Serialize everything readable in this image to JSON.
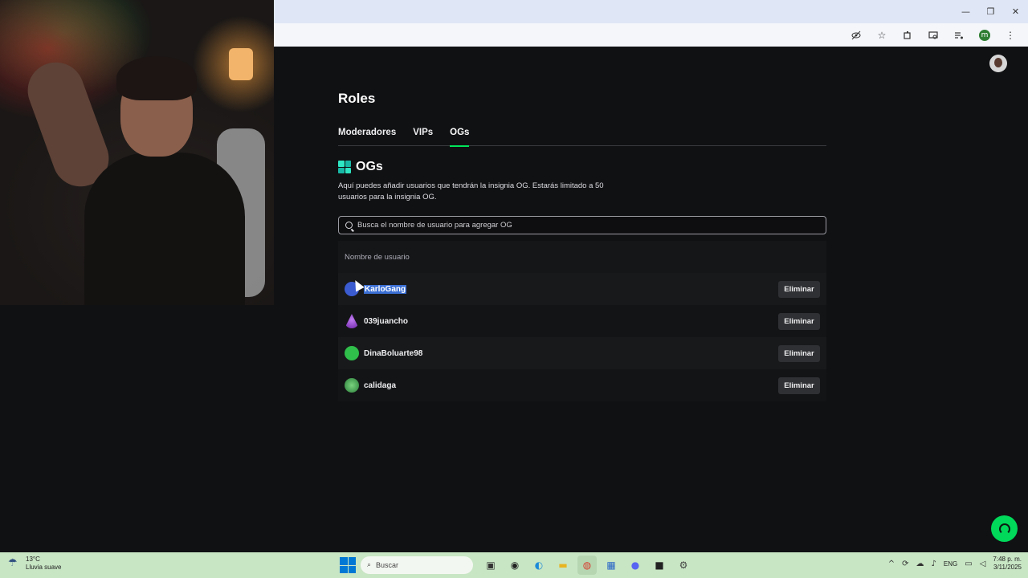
{
  "browser": {
    "window_controls": [
      "—",
      "❐",
      "✕"
    ],
    "toolbar_icons": [
      "eye-off-icon",
      "star-icon",
      "extensions-icon",
      "cast-icon",
      "media-icon"
    ],
    "profile_initial": "m"
  },
  "page": {
    "title": "Roles",
    "tabs": [
      {
        "label": "Moderadores",
        "active": false
      },
      {
        "label": "VIPs",
        "active": false
      },
      {
        "label": "OGs",
        "active": true
      }
    ],
    "section": {
      "title": "OGs",
      "description": "Aquí puedes añadir usuarios que tendrán la insignia OG. Estarás limitado a 50 usuarios para la insignia OG."
    },
    "search": {
      "placeholder": "Busca el nombre de usuario para agregar OG",
      "value": ""
    },
    "table": {
      "header": "Nombre de usuario",
      "remove_label": "Eliminar",
      "rows": [
        {
          "username": "KarloGang",
          "avatar_color": "#3b5bd1",
          "selected": true
        },
        {
          "username": "039juancho",
          "avatar_color": "#9b3fd6",
          "selected": false
        },
        {
          "username": "DinaBoluarte98",
          "avatar_color": "#2fbf4a",
          "selected": false
        },
        {
          "username": "calidaga",
          "avatar_color": "#2fae4b",
          "selected": false
        }
      ]
    }
  },
  "taskbar": {
    "weather": {
      "temp": "13°C",
      "desc": "Lluvia suave"
    },
    "search_label": "Buscar",
    "language": "ENG",
    "time": "7:48 p. m.",
    "date": "3/11/2025"
  },
  "colors": {
    "accent": "#00e55b",
    "background": "#101113"
  }
}
